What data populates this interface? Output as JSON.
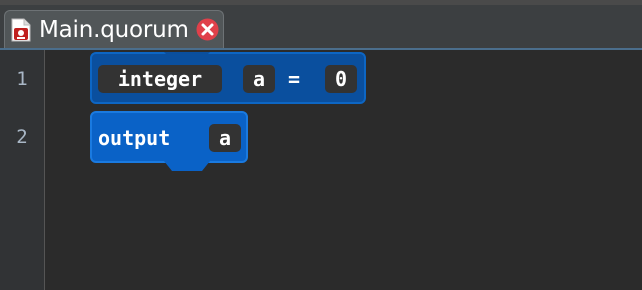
{
  "tab": {
    "title": "Main.quorum",
    "icon": "quorum-file-icon",
    "close_icon": "close-icon",
    "close_color": "#e0404a"
  },
  "gutter": {
    "line_numbers": [
      "1",
      "2"
    ]
  },
  "code": {
    "line1": {
      "keyword": "integer",
      "variable": "a",
      "operator": "=",
      "value": "0"
    },
    "line2": {
      "keyword": "output",
      "variable": "a"
    }
  },
  "colors": {
    "background": "#2b2b2b",
    "block_declaration": "#0a4f9e",
    "block_output": "#0a62c7",
    "token_pill": "#333333"
  }
}
